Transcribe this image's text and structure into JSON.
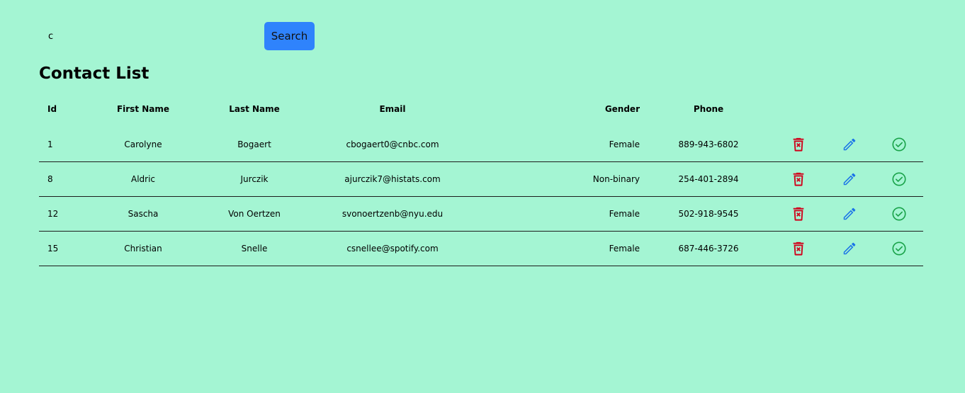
{
  "search": {
    "value": "c",
    "placeholder": "",
    "button_label": "Search"
  },
  "page_title": "Contact List",
  "table": {
    "columns": [
      "Id",
      "First Name",
      "Last Name",
      "Email",
      "Gender",
      "Phone"
    ],
    "rows": [
      {
        "id": "1",
        "first_name": "Carolyne",
        "last_name": "Bogaert",
        "email": "cbogaert0@cnbc.com",
        "gender": "Female",
        "phone": "889-943-6802"
      },
      {
        "id": "8",
        "first_name": "Aldric",
        "last_name": "Jurczik",
        "email": "ajurczik7@histats.com",
        "gender": "Non-binary",
        "phone": "254-401-2894"
      },
      {
        "id": "12",
        "first_name": "Sascha",
        "last_name": "Von Oertzen",
        "email": "svonoertzenb@nyu.edu",
        "gender": "Female",
        "phone": "502-918-9545"
      },
      {
        "id": "15",
        "first_name": "Christian",
        "last_name": "Snelle",
        "email": "csnellee@spotify.com",
        "gender": "Female",
        "phone": "687-446-3726"
      }
    ],
    "row_actions": [
      {
        "name": "delete",
        "icon": "trash-icon",
        "color": "#d0021b"
      },
      {
        "name": "edit",
        "icon": "pencil-icon",
        "color": "#1a73e8"
      },
      {
        "name": "confirm",
        "icon": "check-circle-icon",
        "color": "#1aa34a"
      }
    ]
  },
  "colors": {
    "background": "#a4f5d3",
    "search_button": "#2f83fc",
    "row_divider": "#1c1c1c"
  }
}
